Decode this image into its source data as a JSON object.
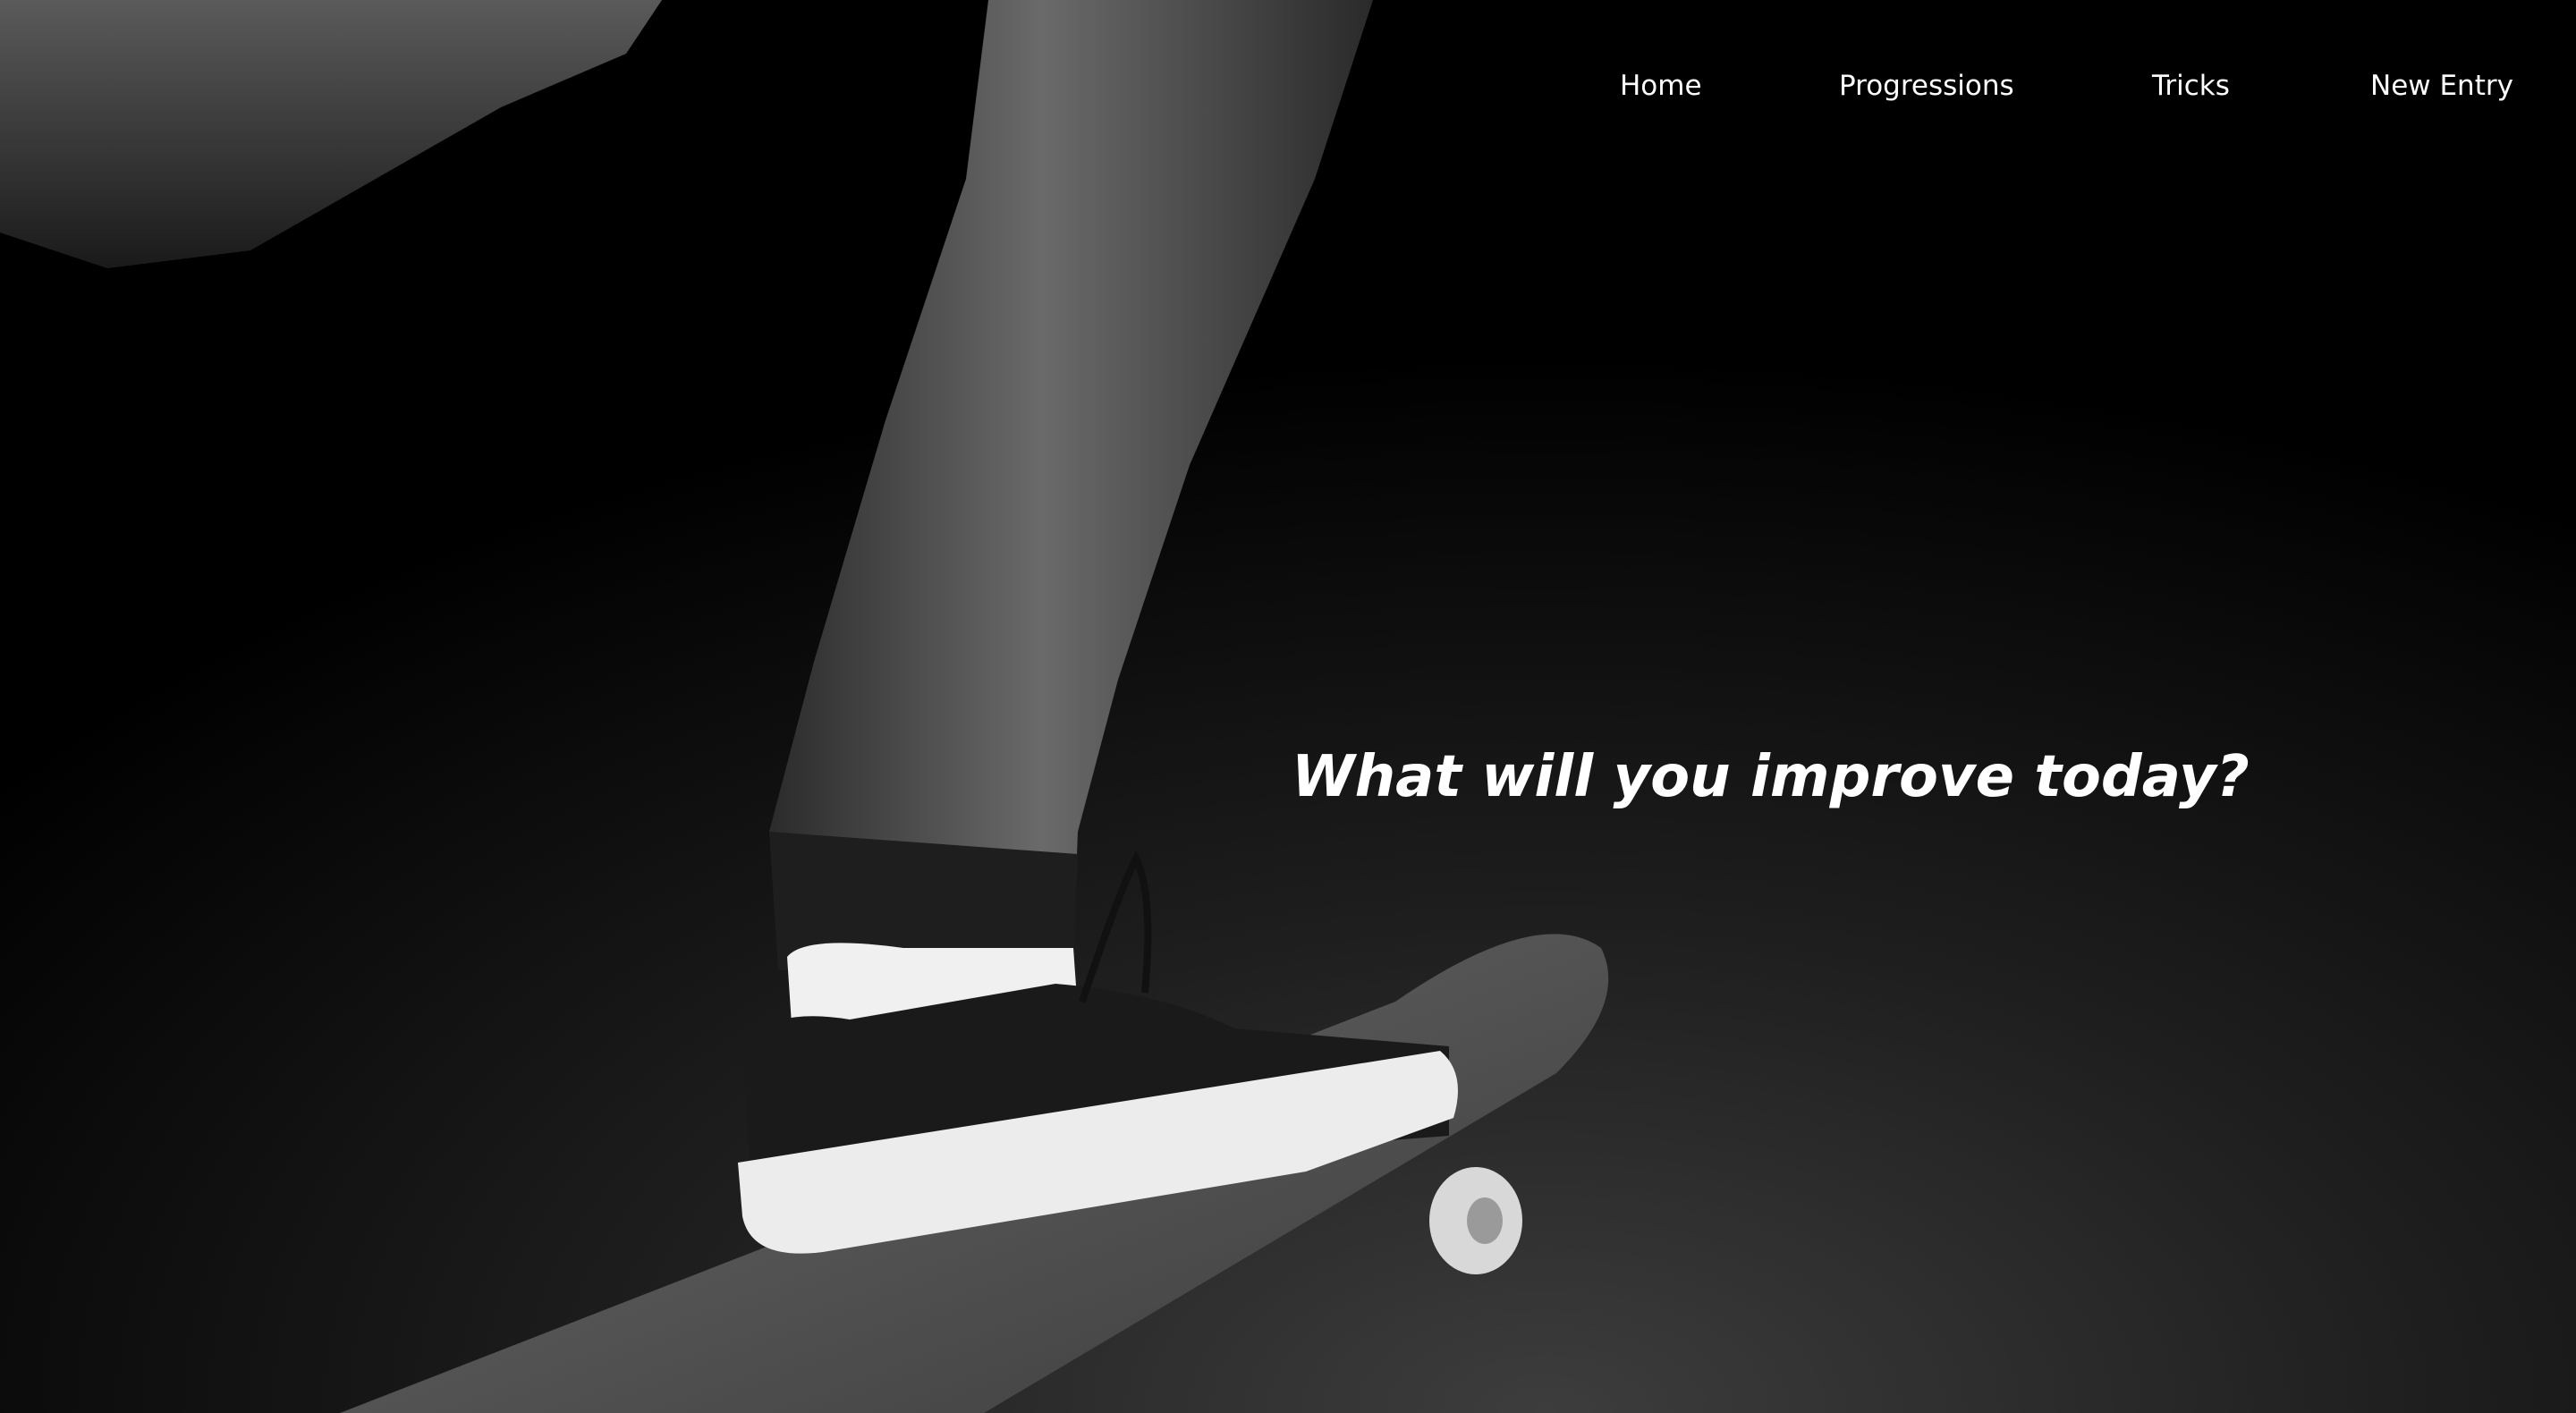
{
  "nav": {
    "items": [
      {
        "label": "Home"
      },
      {
        "label": "Progressions"
      },
      {
        "label": "Tricks"
      },
      {
        "label": "New Entry"
      }
    ]
  },
  "hero": {
    "headline": "What will you improve today?",
    "image": "skateboarder-foot-on-board-photo"
  }
}
